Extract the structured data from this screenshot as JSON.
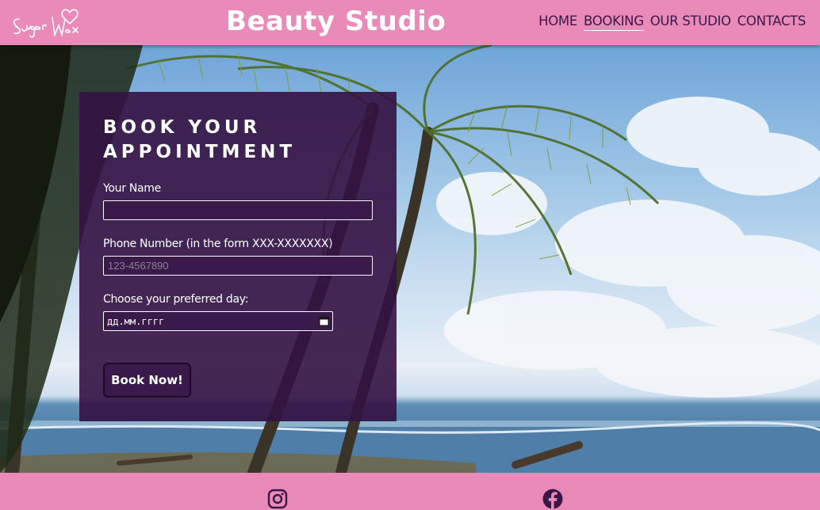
{
  "header": {
    "logo_text": "Sugar Wax",
    "title": "Beauty Studio",
    "nav": [
      {
        "label": "HOME",
        "active": false
      },
      {
        "label": "BOOKING",
        "active": true
      },
      {
        "label": "OUR STUDIO",
        "active": false
      },
      {
        "label": "CONTACTS",
        "active": false
      }
    ]
  },
  "form": {
    "heading": "BOOK YOUR APPOINTMENT",
    "name_label": "Your Name",
    "name_value": "",
    "phone_label": "Phone Number (in the form XXX-XXXXXXX)",
    "phone_placeholder": "123-4567890",
    "day_label": "Choose your preferred day:",
    "day_value": "дд.мм.гггг",
    "submit_label": "Book Now!"
  },
  "footer": {
    "icons": [
      "instagram-icon",
      "facebook-icon"
    ]
  },
  "colors": {
    "brand_pink": "#e98ab8",
    "panel_purple": "#341242",
    "nav_text": "#3b1747"
  }
}
